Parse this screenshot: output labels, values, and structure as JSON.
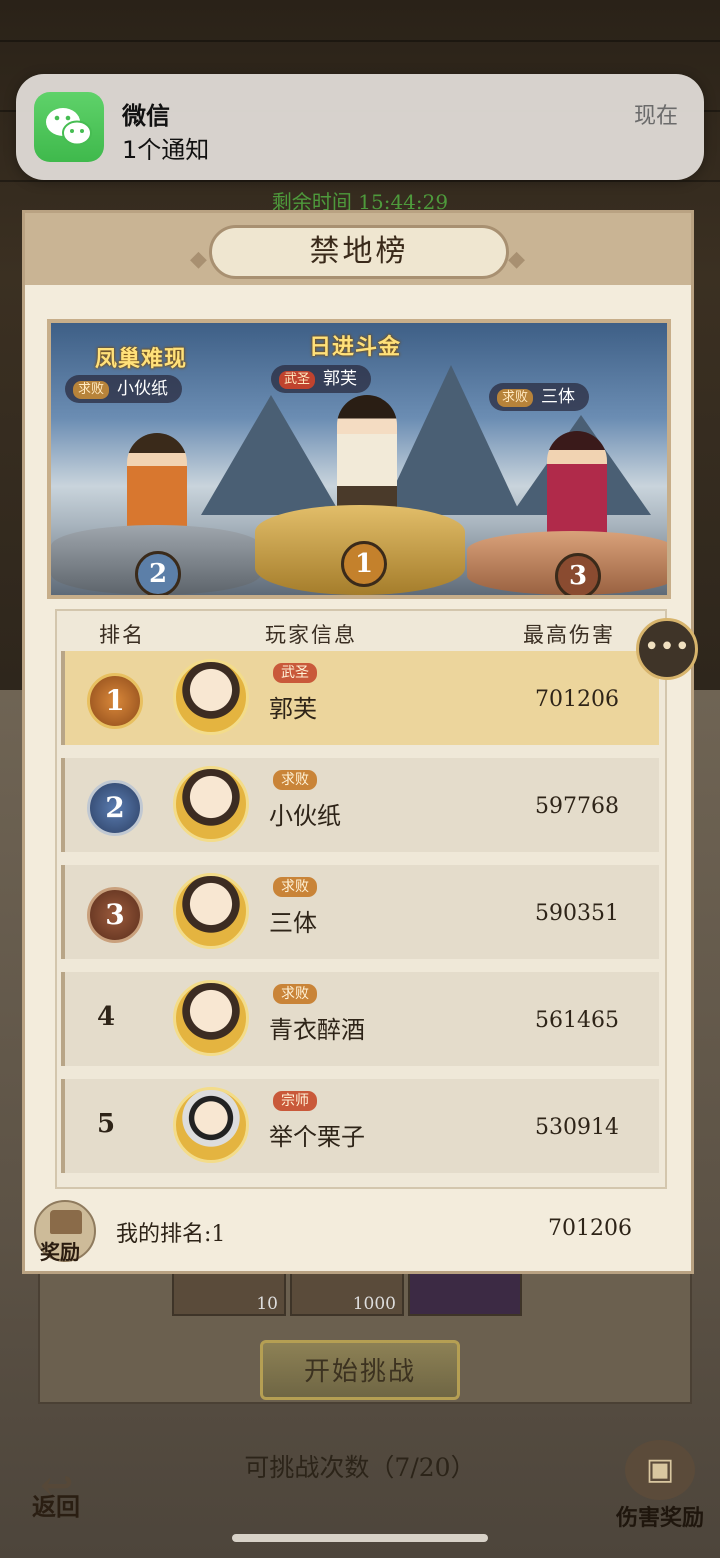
{
  "notification": {
    "app": "微信",
    "body": "1个通知",
    "time": "现在"
  },
  "game": {
    "timer": "剩余时间 15:44:29",
    "start_button": "开始挑战",
    "challenges": "可挑战次数（7/20）",
    "back_label": "返回",
    "damage_reward_label": "伤害奖励",
    "slot_values": [
      "10",
      "1000"
    ]
  },
  "panel": {
    "title": "禁地榜",
    "podium": {
      "banner_left": "凤巢难现",
      "banner_center": "日进斗金",
      "first": {
        "tag": "武圣",
        "name": "郭芙",
        "rank": "1"
      },
      "second": {
        "tag": "求败",
        "name": "小伙纸",
        "rank": "2"
      },
      "third": {
        "tag": "求败",
        "name": "三体",
        "rank": "3"
      }
    },
    "headers": {
      "rank": "排名",
      "player": "玩家信息",
      "damage": "最高伤害"
    },
    "rows": [
      {
        "rank": "1",
        "tag": "武圣",
        "name": "郭芙",
        "damage": "701206"
      },
      {
        "rank": "2",
        "tag": "求败",
        "name": "小伙纸",
        "damage": "597768"
      },
      {
        "rank": "3",
        "tag": "求败",
        "name": "三体",
        "damage": "590351"
      },
      {
        "rank": "4",
        "tag": "求败",
        "name": "青衣醉酒",
        "damage": "561465"
      },
      {
        "rank": "5",
        "tag": "宗师",
        "name": "举个栗子",
        "damage": "530914"
      }
    ],
    "my_rank": "我的排名:1",
    "my_damage": "701206",
    "reward_label": "奖励"
  },
  "colors": {
    "first_row": "#ecd59c",
    "row": "#e4dccb",
    "gold": "#c9a24a",
    "silver": "#8a97a6",
    "bronze": "#9a5a3c",
    "wechat_green": "#3fb94c"
  }
}
